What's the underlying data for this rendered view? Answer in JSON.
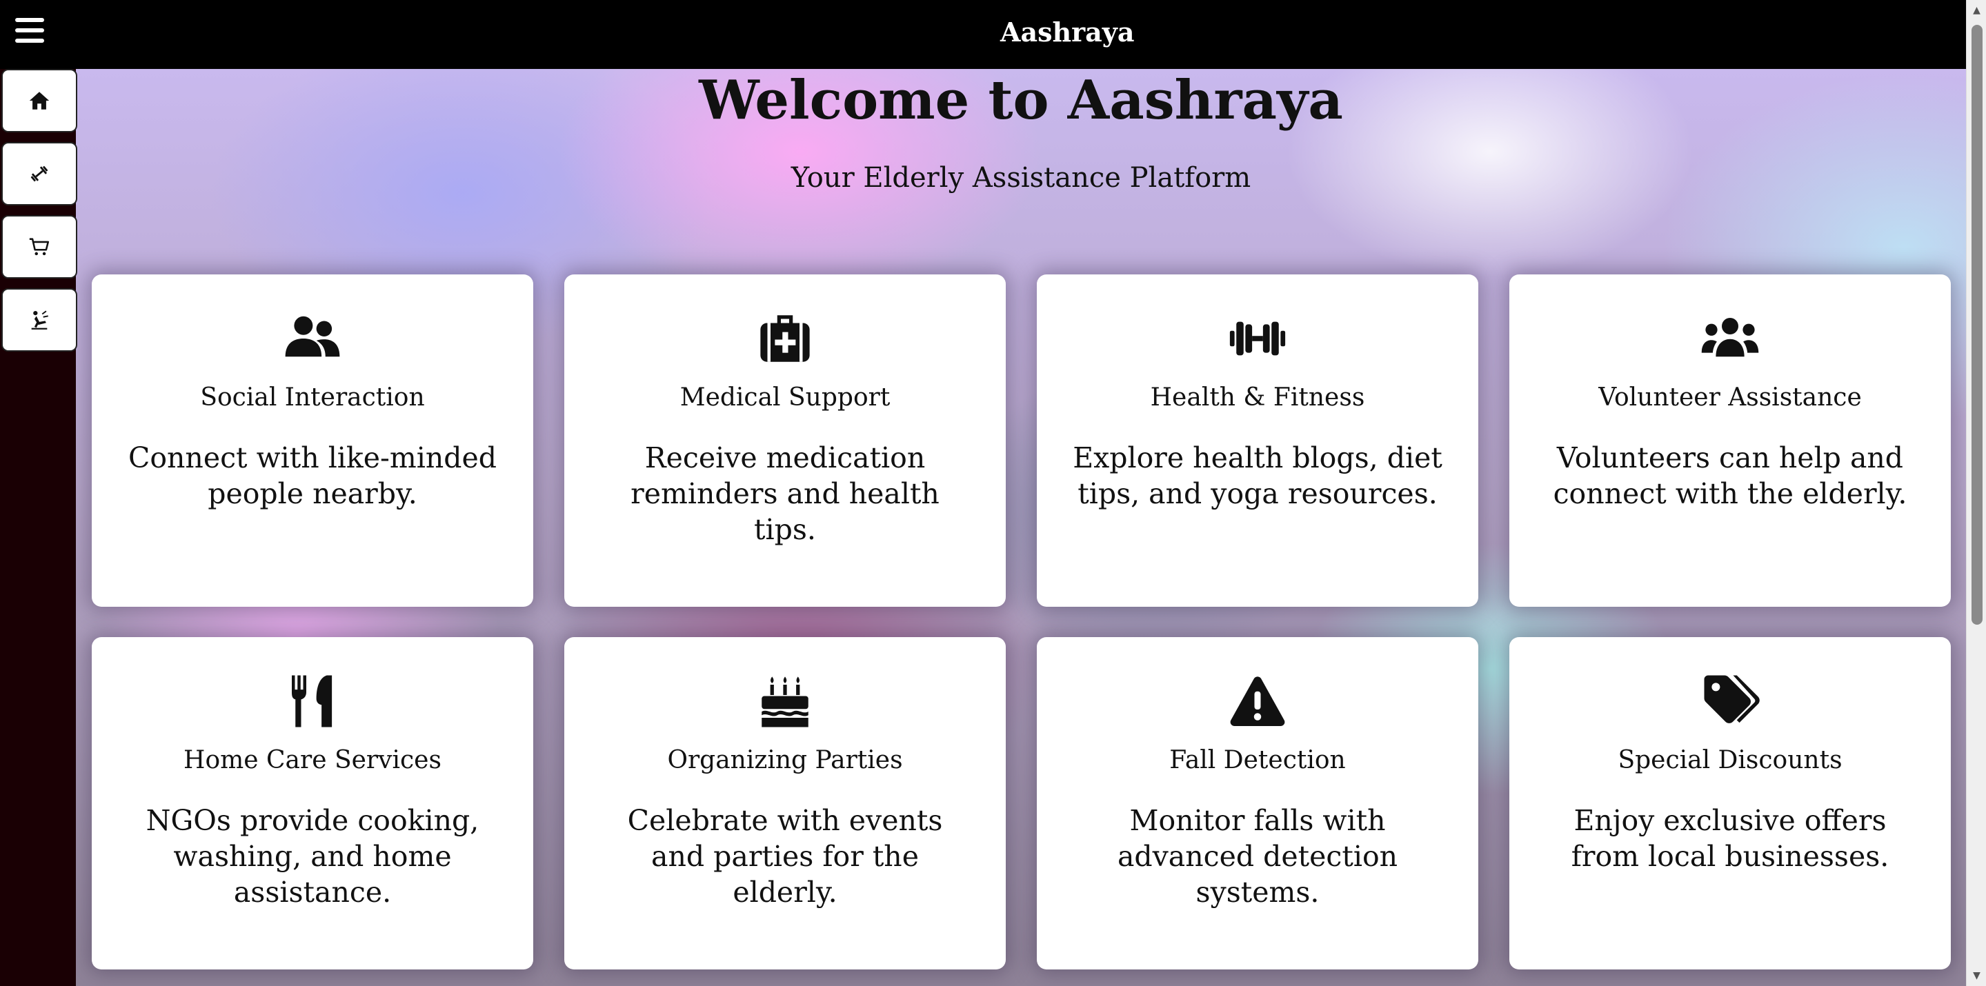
{
  "header": {
    "app_title": "Aashraya"
  },
  "sidebar": {
    "items": [
      {
        "name": "home",
        "icon": "home-icon"
      },
      {
        "name": "fitness",
        "icon": "dumbbell-icon"
      },
      {
        "name": "shop",
        "icon": "cart-icon"
      },
      {
        "name": "fall-detection",
        "icon": "person-falling-icon"
      }
    ]
  },
  "hero": {
    "title": "Welcome to Aashraya",
    "subtitle": "Your Elderly Assistance Platform"
  },
  "cards": [
    {
      "icon": "user-group-icon",
      "title": "Social Interaction",
      "desc": "Connect with like-minded people nearby."
    },
    {
      "icon": "medical-kit-icon",
      "title": "Medical Support",
      "desc": "Receive medication reminders and health tips."
    },
    {
      "icon": "dumbbell-icon",
      "title": "Health & Fitness",
      "desc": "Explore health blogs, diet tips, and yoga resources."
    },
    {
      "icon": "users-icon",
      "title": "Volunteer Assistance",
      "desc": "Volunteers can help and connect with the elderly."
    },
    {
      "icon": "utensils-icon",
      "title": "Home Care Services",
      "desc": "NGOs provide cooking, washing, and home assistance."
    },
    {
      "icon": "birthday-cake-icon",
      "title": "Organizing Parties",
      "desc": "Celebrate with events and parties for the elderly."
    },
    {
      "icon": "warning-triangle-icon",
      "title": "Fall Detection",
      "desc": "Monitor falls with advanced detection systems."
    },
    {
      "icon": "tags-icon",
      "title": "Special Discounts",
      "desc": "Enjoy exclusive offers from local businesses."
    }
  ],
  "colors": {
    "topbar": "#000000",
    "sidebar": "#1a0004",
    "card": "#ffffff",
    "text": "#111111"
  }
}
